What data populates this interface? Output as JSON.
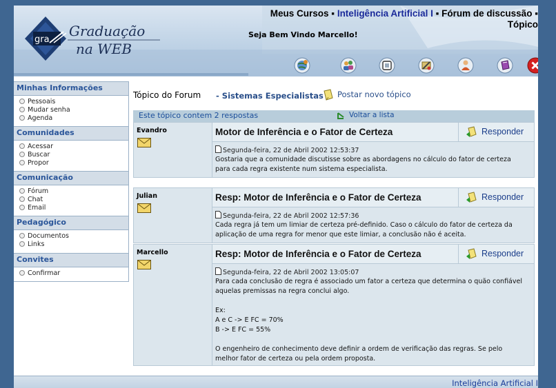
{
  "header": {
    "logo": {
      "small_text": "gra",
      "line1": "Graduação",
      "line2": "na WEB"
    },
    "breadcrumb": {
      "item1": "Meus Cursos",
      "sep1": " ▪ ",
      "item2": "Inteligência Artificial I",
      "sep2": " ▪ ",
      "item3": "Fórum de discussão",
      "sep3": " ▪",
      "item4": "Tópico"
    },
    "welcome": "Seja Bem Vindo Marcello!",
    "toolbar_icons": [
      "globe-icon",
      "users-icon",
      "chip-icon",
      "tools-icon",
      "person-icon",
      "book-icon",
      "exit-icon"
    ]
  },
  "sidebar": {
    "sections": [
      {
        "title": "Minhas Informações",
        "items": [
          "Pessoais",
          "Mudar senha",
          "Agenda"
        ]
      },
      {
        "title": "Comunidades",
        "items": [
          "Acessar",
          "Buscar",
          "Propor"
        ]
      },
      {
        "title": "Comunicação",
        "items": [
          "Fórum",
          "Chat",
          "Email"
        ]
      },
      {
        "title": "Pedagógico",
        "items": [
          "Documentos",
          "Links"
        ]
      },
      {
        "title": "Convites",
        "items": [
          "Confirmar"
        ]
      }
    ]
  },
  "main": {
    "topic_label": "Tópico do Forum",
    "topic_sep": " - ",
    "topic_name": "Sistemas Especialistas",
    "new_topic": "Postar novo tópico",
    "reply_count": "Este tópico contem 2 respostas",
    "back_to_list": "Voltar a lista"
  },
  "posts": [
    {
      "author": "Evandro",
      "title": "Motor de Inferência e o Fator de Certeza",
      "reply_label": "Responder",
      "date": "Segunda-feira, 22 de Abril 2002 12:53:37",
      "text": "Gostaria que a comunidade discutisse sobre as abordagens no cálculo do fator de certeza para cada regra existente num sistema especialista."
    },
    {
      "author": "Julian",
      "title": "Resp: Motor de Inferência e o Fator de Certeza",
      "reply_label": "Responder",
      "date": "Segunda-feira, 22 de Abril 2002 12:57:36",
      "text": "Cada regra já tem um limiar de certeza pré-definido. Caso o cálculo do fator de certeza da aplicação de uma regra for menor que este limiar, a conclusão não é aceita."
    },
    {
      "author": "Marcello",
      "title": "Resp: Motor de Inferência e o Fator de Certeza",
      "reply_label": "Responder",
      "date": "Segunda-feira, 22 de Abril 2002 13:05:07",
      "text": "Para cada conclusão de regra é associado um fator a certeza que determina o quão confiável aquelas premissas na regra conclui algo.\n\nEx:\nA e C -> E FC = 70%\nB -> E FC = 55%\n\nO engenheiro de conhecimento deve definir a ordem de verificação das regras. Se pelo melhor fator de certeza ou pela ordem proposta."
    }
  ],
  "footer": {
    "link": "Inteligência Artificial I"
  },
  "colors": {
    "background": "#3f6691",
    "accent": "#2a5599",
    "post_bg": "#dce6ed"
  }
}
